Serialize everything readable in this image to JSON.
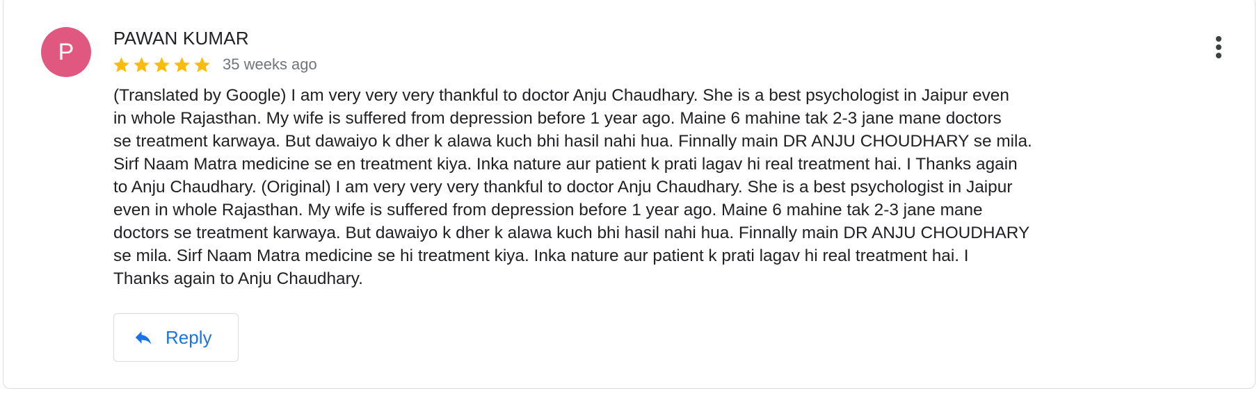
{
  "review": {
    "author_initial": "P",
    "author_name": "PAWAN KUMAR",
    "rating": 5,
    "rating_max": 5,
    "time_ago": "35 weeks ago",
    "text": "(Translated by Google) I am very very very thankful to doctor Anju Chaudhary. She is a best psychologist in Jaipur even\nin whole Rajasthan. My wife is suffered from depression before 1 year ago. Maine 6 mahine tak 2-3 jane mane doctors\nse treatment karwaya. But dawaiyo k dher k alawa kuch bhi hasil nahi hua. Finnally main DR ANJU CHOUDHARY se mila.\nSirf Naam Matra medicine se en treatment kiya. Inka nature aur patient k prati lagav hi real treatment hai. I Thanks again\nto Anju Chaudhary. (Original) I am very very very thankful to doctor Anju Chaudhary. She is a best psychologist in Jaipur\neven in whole Rajasthan. My wife is suffered from depression before 1 year ago. Maine 6 mahine tak 2-3 jane mane\ndoctors se treatment karwaya. But dawaiyo k dher k alawa kuch bhi hasil nahi hua. Finnally main DR ANJU CHOUDHARY\nse mila. Sirf Naam Matra medicine se hi treatment kiya. Inka nature aur patient k prati lagav hi real treatment hai. I\nThanks again to Anju Chaudhary."
  },
  "actions": {
    "reply_label": "Reply",
    "reply_icon": "reply-arrow-icon",
    "more_icon": "more-vertical-icon"
  },
  "colors": {
    "avatar_bg": "#e0577f",
    "star": "#fbbc04",
    "accent": "#1a73e8",
    "more_icon": "#3c4043"
  }
}
